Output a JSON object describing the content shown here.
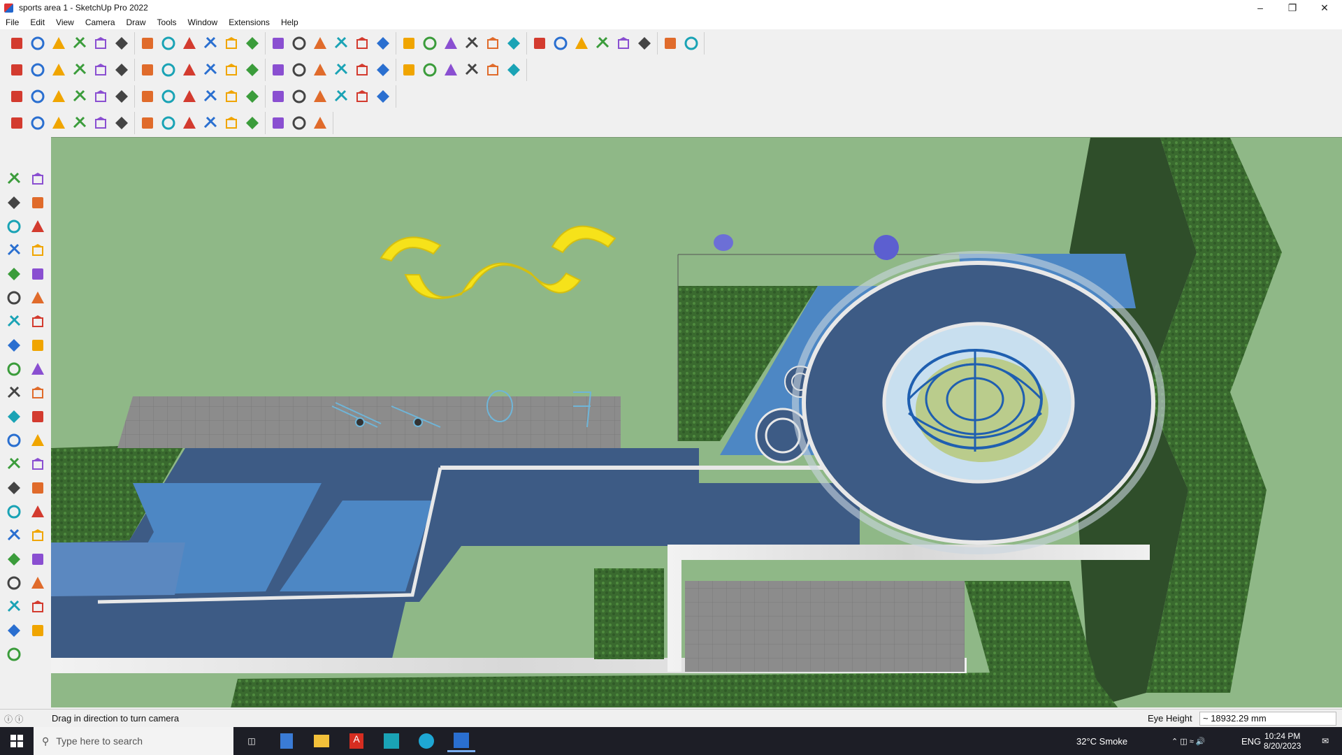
{
  "window": {
    "title": "sports area 1 - SketchUp Pro 2022"
  },
  "menu": [
    "File",
    "Edit",
    "View",
    "Camera",
    "Draw",
    "Tools",
    "Window",
    "Extensions",
    "Help"
  ],
  "toolbar_icons": {
    "row1": [
      "zoom-icon",
      "select-icon",
      "eraser-icon",
      "pencil-icon",
      "arc-icon",
      "rectangle-icon",
      "pushpull-icon",
      "followme-icon",
      "move-icon",
      "rotate-icon",
      "scale-icon",
      "tape-icon",
      "text-icon",
      "paint-icon",
      "orbit-icon",
      "pan-icon",
      "zoom-window-icon",
      "zoom-extents-icon",
      "previous-icon",
      "section-icon",
      "layers-icon",
      "components-icon",
      "styles-icon",
      "model-info-icon",
      "warehouse-icon",
      "extension-icon",
      "sandbox-icon",
      "axes-icon",
      "dimension-icon",
      "undo-icon",
      "redo-icon",
      "unknown-icon"
    ],
    "row2": [
      "iso-icon",
      "top-icon",
      "front-icon",
      "right-icon",
      "back-icon",
      "left-icon",
      "bottom-icon",
      "xray-icon",
      "wireframe-icon",
      "hidden-line-icon",
      "shaded-icon",
      "textured-icon",
      "monochrome-icon",
      "house-icon",
      "tag-icon",
      "shadow-icon",
      "fog-icon",
      "polygon-icon",
      "circle-icon",
      "hexagon-icon",
      "ellipse-icon",
      "parallelogram-icon",
      "bezier-icon",
      "spiral-icon"
    ],
    "row3": [
      "extrude-icon",
      "offset-icon",
      "cut-icon",
      "join-icon",
      "split-icon",
      "curve-icon",
      "weld-icon",
      "plus-icon",
      "explode-icon",
      "flip-icon",
      "triangle-icon",
      "loop-icon",
      "rotate-array-icon",
      "grid-icon",
      "chain-icon",
      "box-icon",
      "sphere-icon",
      "gear-icon"
    ],
    "row4": [
      "nurbs-icon",
      "spline-icon",
      "draw-icon",
      "line-icon",
      "shape-icon",
      "tube-icon",
      "fillet-icon",
      "stair-icon",
      "railing-icon",
      "wall-icon",
      "beam-icon",
      "roof-icon",
      "column-icon",
      "fence-icon",
      "door-icon"
    ]
  },
  "left_tools": [
    "select",
    "orbit",
    "paint",
    "eraser",
    "component",
    "tape",
    "line",
    "freehand",
    "rectangle",
    "rotated-rect",
    "circle",
    "polygon",
    "arc",
    "pie",
    "arc-2pt",
    "arc-3pt",
    "move",
    "pushpull",
    "rotate",
    "followme",
    "scale",
    "offset",
    "tape-measure",
    "text",
    "protractor",
    "axes",
    "dimension",
    "3d-text",
    "orbit-tool",
    "pan",
    "zoom",
    "zoom-window",
    "zoom-extents",
    "previous",
    "position-camera",
    "look-around",
    "walk",
    "section-plane",
    "display-section",
    "section-cuts",
    "section-fill"
  ],
  "status": {
    "hint": "Drag in direction to turn camera",
    "measure_label": "Eye Height",
    "measure_value": "~ 18932.29 mm"
  },
  "taskbar": {
    "search_placeholder": "Type here to search",
    "weather": "32°C  Smoke",
    "language": "ENG",
    "time": "10:24 PM",
    "date": "8/20/2023"
  },
  "colors": {
    "grass": "#8fb887",
    "path": "#3d5b85",
    "water": "#4d87c4",
    "wall": "#e8e8e8",
    "yellow": "#f6e21a",
    "hedge": "#2f4e2a"
  }
}
